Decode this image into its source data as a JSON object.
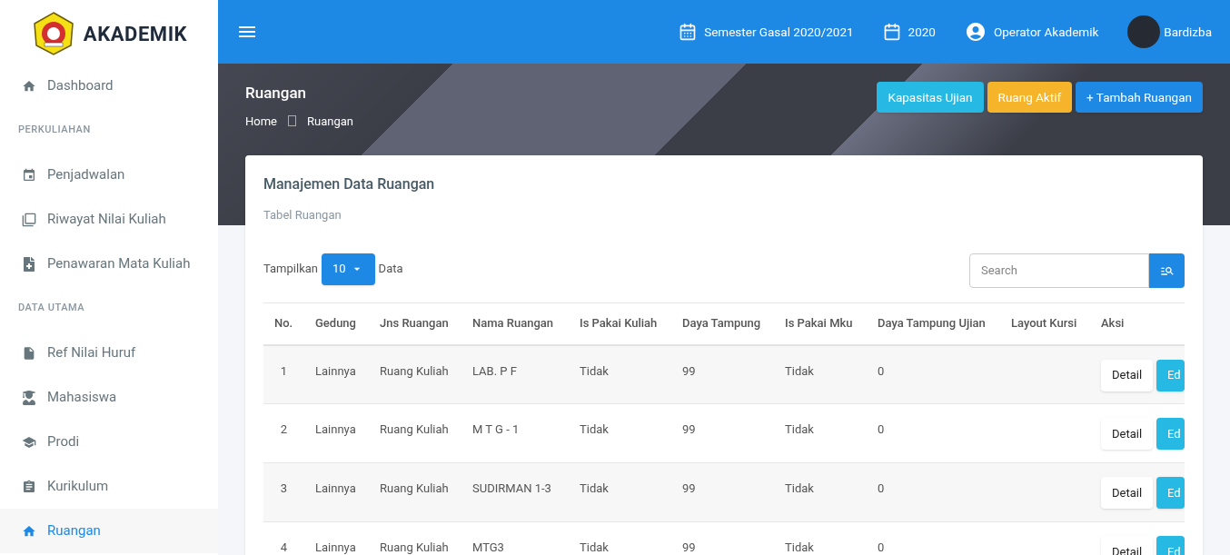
{
  "brand": {
    "name": "AKADEMIK"
  },
  "sidebar": {
    "items": [
      {
        "kind": "link",
        "label": "Dashboard",
        "selected": false
      },
      {
        "kind": "section",
        "label": "PERKULIAHAN"
      },
      {
        "kind": "link",
        "label": "Penjadwalan",
        "selected": false
      },
      {
        "kind": "link",
        "label": "Riwayat Nilai Kuliah",
        "selected": false
      },
      {
        "kind": "link",
        "label": "Penawaran Mata Kuliah",
        "selected": false
      },
      {
        "kind": "section",
        "label": "DATA UTAMA"
      },
      {
        "kind": "link",
        "label": "Ref Nilai Huruf",
        "selected": false
      },
      {
        "kind": "link",
        "label": "Mahasiswa",
        "selected": false
      },
      {
        "kind": "link",
        "label": "Prodi",
        "selected": false
      },
      {
        "kind": "link",
        "label": "Kurikulum",
        "selected": false
      },
      {
        "kind": "link",
        "label": "Ruangan",
        "selected": true
      }
    ]
  },
  "topbar": {
    "semester": "Semester Gasal 2020/2021",
    "year": "2020",
    "role": "Operator Akademik",
    "user": "Bardizba"
  },
  "page": {
    "title": "Ruangan",
    "breadcrumb": [
      "Home",
      "Ruangan"
    ],
    "actions": [
      {
        "label": "Kapasitas Ujian",
        "color": "#26b9e3"
      },
      {
        "label": "Ruang Aktif",
        "color": "#f6b42a"
      },
      {
        "label": "+ Tambah Ruangan",
        "color": "#1e88e5"
      }
    ]
  },
  "card": {
    "title": "Manajemen Data Ruangan",
    "subtitle": "Tabel Ruangan",
    "show_label": "Tampilkan",
    "page_size": "10",
    "show_suffix": "Data",
    "search": {
      "placeholder": "Search"
    }
  },
  "table": {
    "columns": [
      "No.",
      "Gedung",
      "Jns Ruangan",
      "Nama Ruangan",
      "Is Pakai Kuliah",
      "Daya Tampung",
      "Is Pakai Mku",
      "Daya Tampung Ujian",
      "Layout Kursi",
      "Aksi"
    ],
    "rows": [
      {
        "cells": [
          "1",
          "Lainnya",
          "Ruang Kuliah",
          "LAB. P F",
          "Tidak",
          "99",
          "Tidak",
          "0"
        ],
        "actions": [
          "Detail",
          "Ed"
        ]
      },
      {
        "cells": [
          "2",
          "Lainnya",
          "Ruang Kuliah",
          "M T G - 1",
          "Tidak",
          "99",
          "Tidak",
          "0"
        ],
        "actions": [
          "Detail",
          "Ed"
        ]
      },
      {
        "cells": [
          "3",
          "Lainnya",
          "Ruang Kuliah",
          "SUDIRMAN 1-3",
          "Tidak",
          "99",
          "Tidak",
          "0"
        ],
        "actions": [
          "Detail",
          "Ed"
        ]
      },
      {
        "cells": [
          "4",
          "Lainnya",
          "Ruang Kuliah",
          "MTG3",
          "Tidak",
          "99",
          "Tidak",
          "0"
        ],
        "actions": [
          "Detail",
          "Ed"
        ]
      }
    ]
  }
}
